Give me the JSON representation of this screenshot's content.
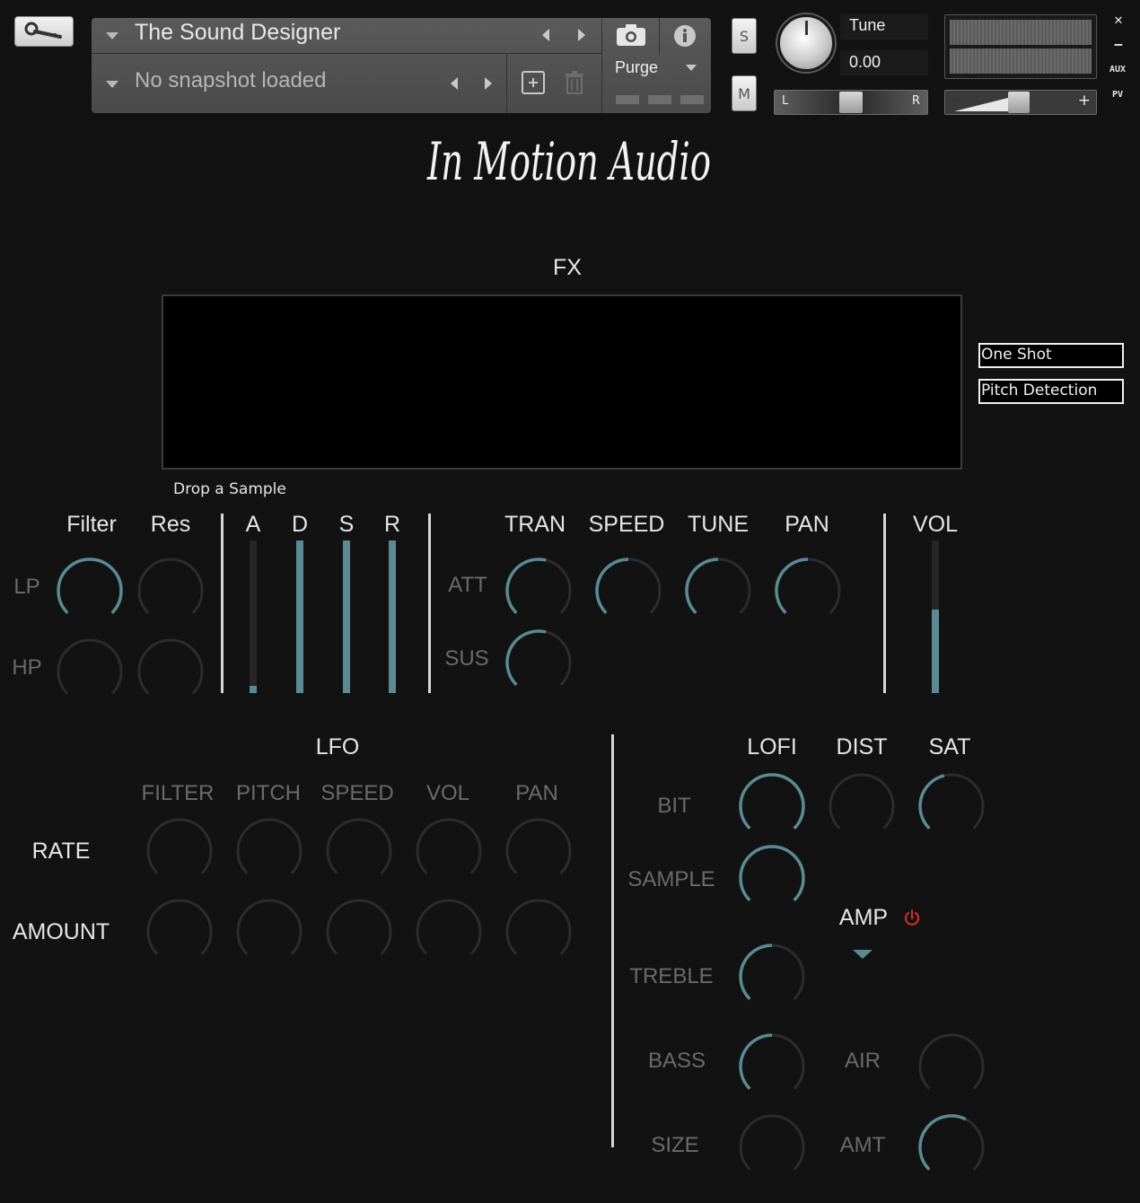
{
  "header": {
    "instrument_name": "The Sound Designer",
    "snapshot_text": "No snapshot loaded",
    "purge_label": "Purge",
    "solo_label": "S",
    "mute_label": "M",
    "tune_label": "Tune",
    "tune_value": "0.00",
    "pan_left": "L",
    "pan_right": "R",
    "vol_minus": "−",
    "vol_plus": "+",
    "close_label": "✕",
    "minimize_label": "−",
    "aux_label": "AUX",
    "pv_label": "PV"
  },
  "logo_text": "In Motion Audio",
  "fx": {
    "title": "FX",
    "drop_label": "Drop a Sample",
    "one_shot_label": "One Shot",
    "pitch_detection_label": "Pitch Detection"
  },
  "filter": {
    "filter_label": "Filter",
    "res_label": "Res",
    "lp_label": "LP",
    "hp_label": "HP"
  },
  "adsr": {
    "a_label": "A",
    "d_label": "D",
    "s_label": "S",
    "r_label": "R",
    "levels": [
      0.05,
      1.0,
      1.0,
      1.0
    ]
  },
  "transient": {
    "tran_label": "TRAN",
    "speed_label": "SPEED",
    "tune_label": "TUNE",
    "pan_label": "PAN",
    "att_label": "ATT",
    "sus_label": "SUS"
  },
  "volume": {
    "label": "VOL",
    "level": 0.55
  },
  "lfo": {
    "title": "LFO",
    "columns": [
      "FILTER",
      "PITCH",
      "SPEED",
      "VOL",
      "PAN"
    ],
    "rate_label": "RATE",
    "amount_label": "AMOUNT"
  },
  "effects": {
    "lofi_label": "LOFI",
    "dist_label": "DIST",
    "sat_label": "SAT",
    "bit_label": "BIT",
    "sample_label": "SAMPLE",
    "amp_label": "AMP",
    "treble_label": "TREBLE",
    "bass_label": "BASS",
    "air_label": "AIR",
    "size_label": "SIZE",
    "amt_label": "AMT"
  },
  "colors": {
    "accent": "#5a8a94",
    "knob_track": "#2c2c2c",
    "power_icon": "#d02a2a",
    "background": "#121212"
  }
}
